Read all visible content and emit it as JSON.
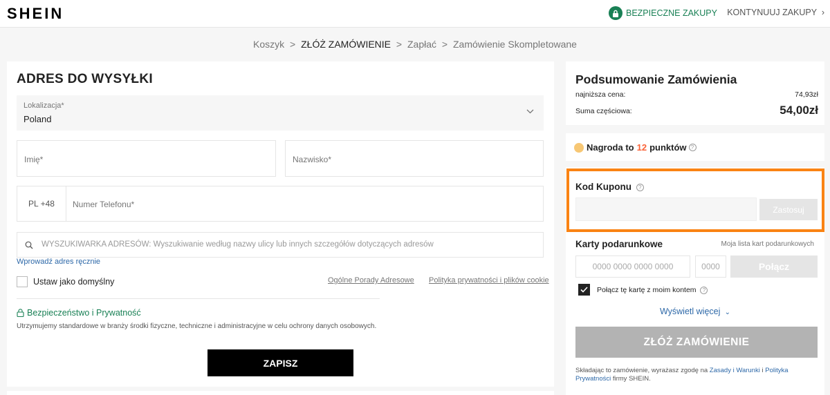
{
  "header": {
    "logo": "SHEIN",
    "secure_label": "BEZPIECZNE ZAKUPY",
    "continue_label": "KONTYNUUJ ZAKUPY"
  },
  "breadcrumb": {
    "items": [
      "Koszyk",
      "ZŁÓŻ ZAMÓWIENIE",
      "Zapłać",
      "Zamówienie Skompletowane"
    ],
    "separator": ">"
  },
  "address": {
    "title": "ADRES DO WYSYŁKI",
    "location_label": "Lokalizacja*",
    "location_value": "Poland",
    "first_name_placeholder": "Imię*",
    "last_name_placeholder": "Nazwisko*",
    "phone_prefix": "PL +48",
    "phone_placeholder": "Numer Telefonu*",
    "search_placeholder": "WYSZUKIWARKA ADRESÓW: Wyszukiwanie według nazwy ulicy lub innych szczegółów dotyczących adresów",
    "manual_link": "Wprowadź adres ręcznie",
    "default_label": "Ustaw jako domyślny",
    "tips_link": "Ogólne Porady Adresowe",
    "privacy_link": "Polityka prywatności i plików cookie",
    "security_title": "Bezpieczeństwo i Prywatność",
    "security_text": "Utrzymujemy standardowe w branży środki fizyczne, techniczne i administracyjne w celu ochrony danych osobowych.",
    "save_label": "ZAPISZ"
  },
  "summary": {
    "title": "Podsumowanie Zamówienia",
    "lowest_label": "najniższa cena:",
    "lowest_value": "74,93zł",
    "subtotal_label": "Suma częściowa:",
    "subtotal_value": "54,00zł",
    "reward_prefix": "Nagroda to",
    "reward_points": "12",
    "reward_suffix": "punktów"
  },
  "coupon": {
    "title": "Kod Kuponu",
    "apply_label": "Zastosuj"
  },
  "gift_cards": {
    "title": "Karty podarunkowe",
    "list_link": "Moja lista kart podarunkowych",
    "card_placeholder": "0000 0000 0000 0000",
    "pin_placeholder": "0000",
    "connect_label": "Połącz",
    "link_label": "Połącz tę kartę z moim kontem",
    "show_more": "Wyświetl więcej"
  },
  "order": {
    "place_label": "ZŁÓŻ ZAMÓWIENIE",
    "terms_prefix": "Składając to zamówienie, wyrażasz zgodę na",
    "terms_link": "Zasady i Warunki",
    "terms_and": "i",
    "privacy_link": "Polityka Prywatności",
    "terms_suffix": "firmy SHEIN."
  },
  "colors": {
    "accent_green": "#198055",
    "highlight_orange": "#fa8313",
    "points_red": "#fa6338",
    "link_blue": "#2d68a8"
  }
}
